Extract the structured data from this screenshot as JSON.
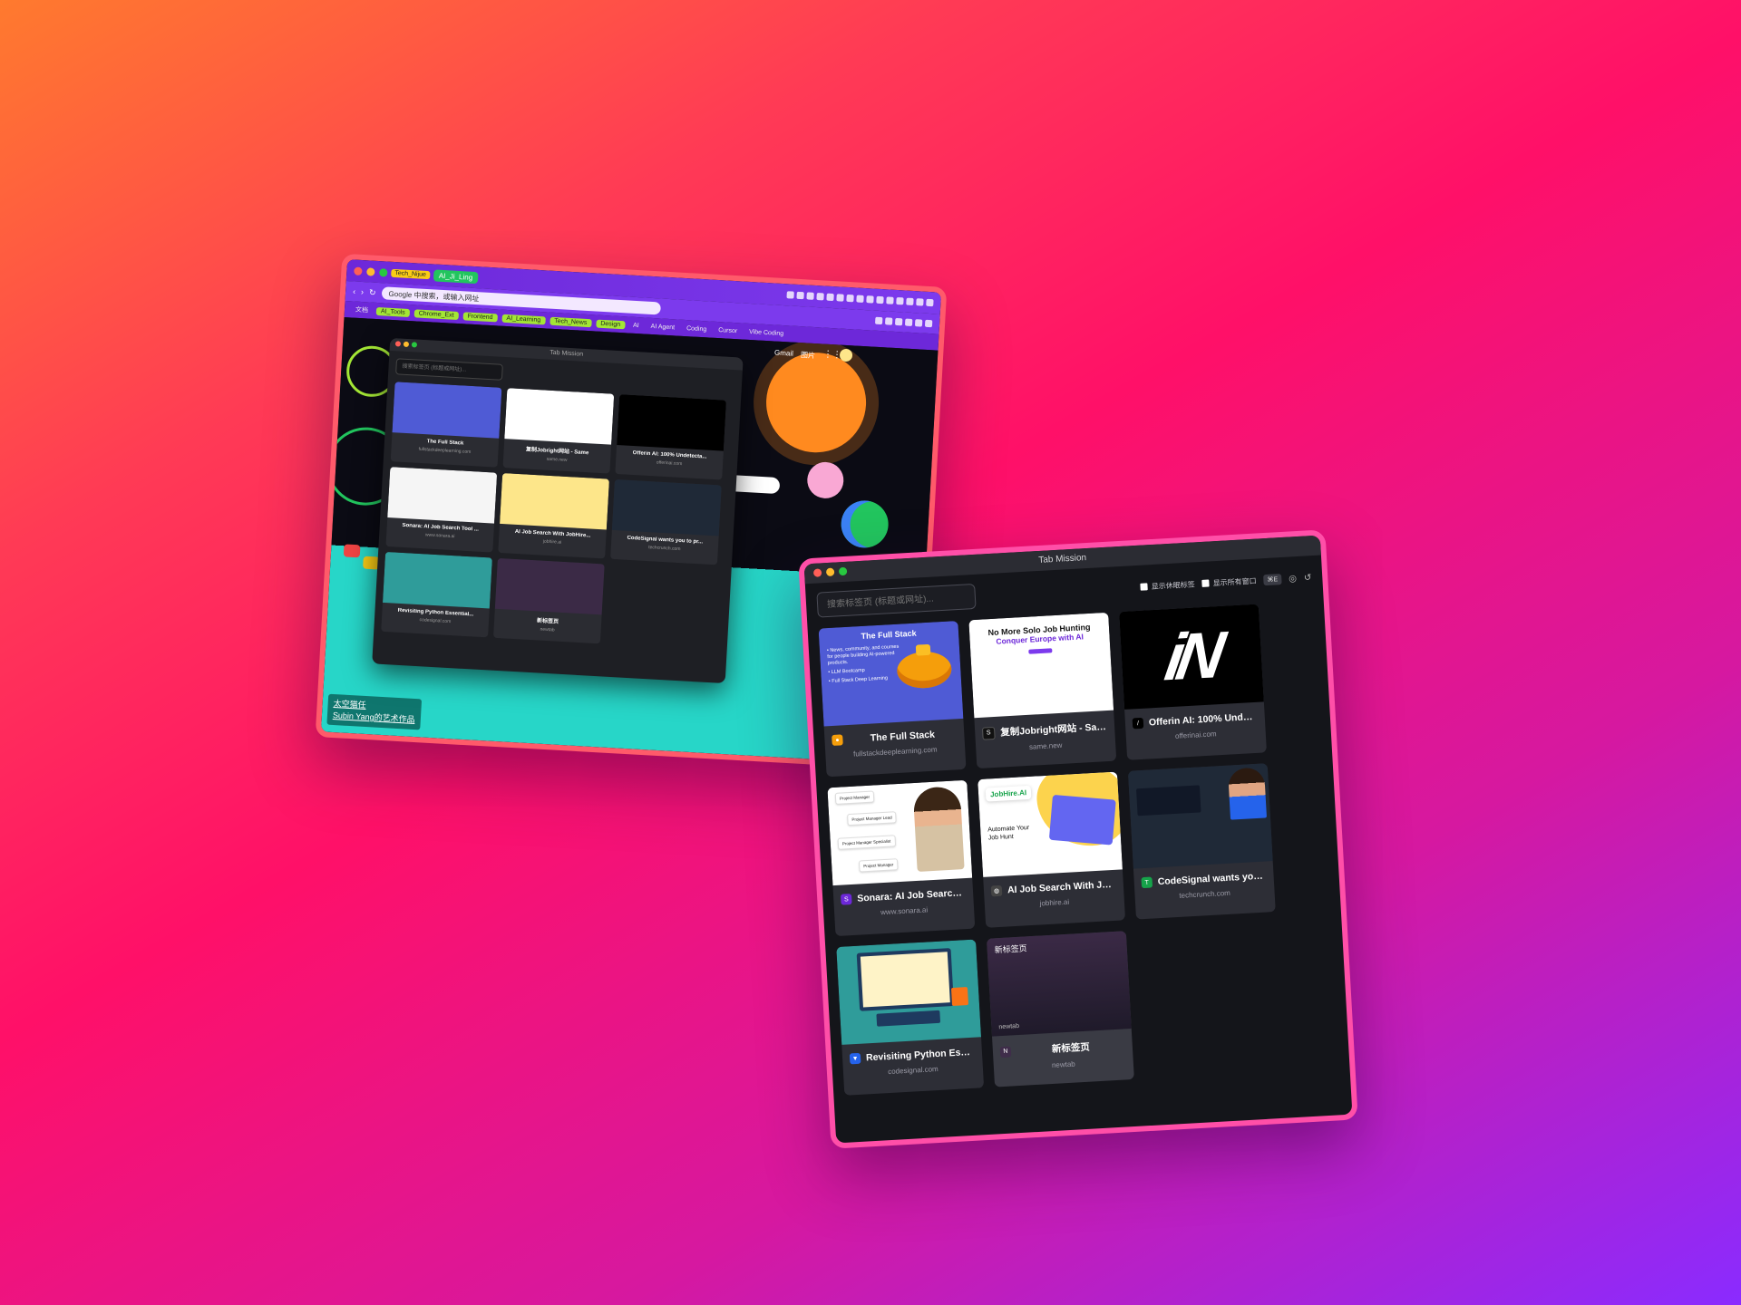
{
  "browser": {
    "tag_label": "Tech_Nijue",
    "tab_active": "AI_Ji_Ling",
    "address": "Google 中搜索，或输入网址",
    "bookmarks": [
      "文档",
      "AI_Tools",
      "Chrome_Ext",
      "Frontend",
      "AI_Learning",
      "Tech_News",
      "Design"
    ],
    "bookmarks_plain": [
      "AI",
      "AI Agent",
      "Coding",
      "Cursor",
      "Vibe Coding"
    ],
    "google_links": [
      "Gmail",
      "图片"
    ],
    "caption_title": "太空猫任",
    "caption_sub": "Subin Yang的艺术作品"
  },
  "mini": {
    "title": "Tab Mission",
    "search_placeholder": "搜索标签页 (标题或网址)..."
  },
  "window": {
    "title": "Tab Mission",
    "search_placeholder": "搜索标签页 (标题或网址)...",
    "toggle_group": "显示休眠标签",
    "toggle_all": "显示所有窗口",
    "shortcut": "⌘E"
  },
  "tabs": [
    {
      "title": "The Full Stack",
      "url": "fullstackdeeplearning.com",
      "thumb_title": "The Full Stack",
      "thumb_lines": [
        "• News, community, and courses for people building AI-powered products.",
        "• LLM Bootcamp",
        "• Full Stack Deep Learning"
      ]
    },
    {
      "title": "复制Jobright网站 - Same",
      "url": "same.new",
      "thumb_a": "No More Solo Job Hunting",
      "thumb_b": "Conquer Europe with AI"
    },
    {
      "title": "Offerin AI: 100% Undetecta...",
      "url": "offerinai.com",
      "thumb_logo": "iN"
    },
    {
      "title": "Sonara: AI Job Search Tool ...",
      "url": "www.sonara.ai",
      "pills": [
        "Project Manager",
        "Project Manager Lead",
        "Project Manager Specialist",
        "Project Manager"
      ]
    },
    {
      "title": "AI Job Search With JobHire...",
      "url": "jobhire.ai",
      "brand": "JobHire.AI",
      "auto_line1": "Automate Your",
      "auto_line2": "Job Hunt"
    },
    {
      "title": "CodeSignal wants you to pr...",
      "url": "techcrunch.com"
    },
    {
      "title": "Revisiting Python Essential...",
      "url": "codesignal.com"
    },
    {
      "title": "新标签页",
      "url": "newtab",
      "thumb_label": "新标签页",
      "thumb_url": "newtab"
    }
  ]
}
